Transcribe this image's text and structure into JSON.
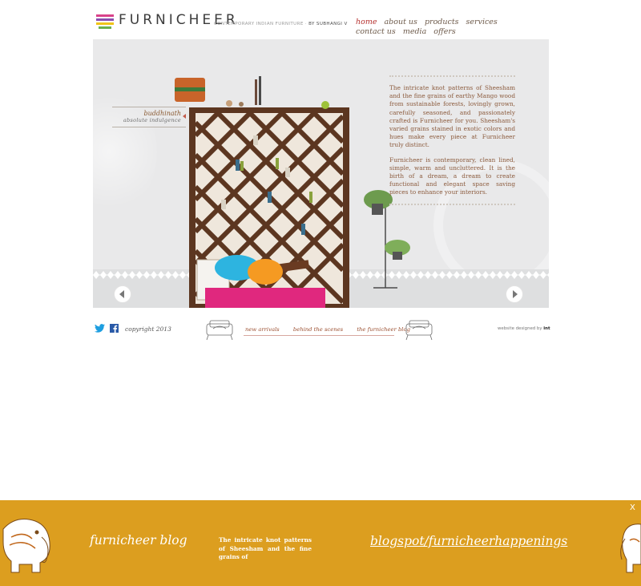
{
  "header": {
    "logo_text": "FURNICHEER",
    "tagline": "CONTEMPORARY INDIAN FURNITURE ·",
    "tagline_author": "BY SUBHANGI V",
    "logo_colors": [
      "#d9428a",
      "#8a4fb0",
      "#f0c419",
      "#6ab04c"
    ]
  },
  "nav": {
    "items": [
      {
        "label": "home",
        "active": true
      },
      {
        "label": "about us"
      },
      {
        "label": "products"
      },
      {
        "label": "services"
      },
      {
        "label": "contact us"
      },
      {
        "label": "media"
      },
      {
        "label": "offers"
      }
    ],
    "active_color": "#b5302e"
  },
  "hero": {
    "caption_title": "buddhinath",
    "caption_subtitle": "absolute indulgence",
    "paragraph1": "The intricate knot patterns of Sheesham and the fine grains of earthy Mango wood from sustainable forests, lovingly grown, carefully seasoned, and passionately crafted is Furnicheer for you. Sheesham's varied grains stained in exotic colors and hues make every piece at Furnicheer truly distinct.",
    "paragraph2": "Furnicheer is contemporary, clean lined, simple, warm and uncluttered. It is the birth of a dream, a dream to create functional and elegant space saving pieces to enhance your interiors."
  },
  "footer": {
    "copyright": "copyright 2013",
    "links": [
      "new arrivals",
      "behind the scenes",
      "the furnicheer blog"
    ],
    "designer_prefix": "website designed by",
    "designer_name": "int"
  },
  "banner": {
    "title": "furnicheer blog",
    "snippet": "The intricate knot patterns of Sheesham and the fine grains of",
    "link": "blogspot/furnicheerhappenings",
    "close_label": "X",
    "background": "#dc9e1f"
  }
}
